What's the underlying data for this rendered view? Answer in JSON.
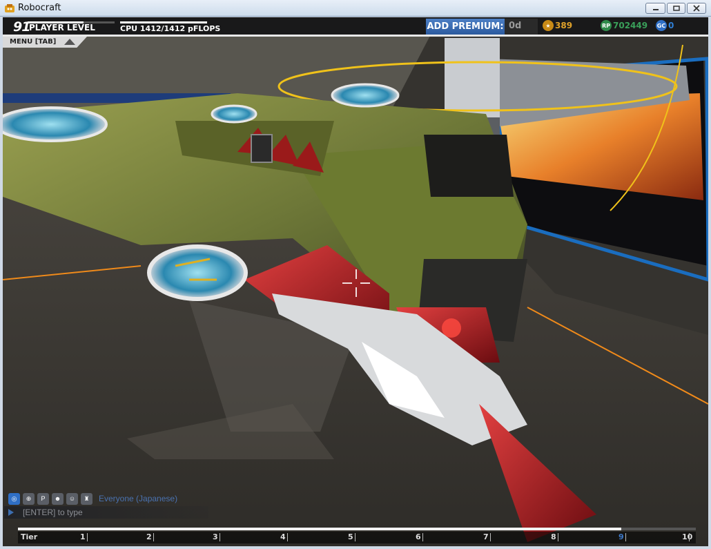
{
  "window": {
    "title": "Robocraft"
  },
  "hud": {
    "player_level": "91",
    "player_level_label": "PLAYER LEVEL",
    "level_progress": 0.64,
    "cpu": "CPU 1412/1412 pFLOPS",
    "add_premium": "ADD PREMIUM:",
    "premium_days": "0d",
    "tech_points": "389",
    "robits": "702449",
    "galaxy_coins": "0",
    "menu": "MENU [TAB]"
  },
  "chat": {
    "channel": "Everyone (Japanese)",
    "placeholder": "[ENTER] to type",
    "icons": [
      "globe-icon",
      "globe-alt-icon",
      "party-icon",
      "friends-icon",
      "friend-add-icon",
      "clan-icon"
    ]
  },
  "tier": {
    "label": "Tier",
    "numbers": [
      "1",
      "2",
      "3",
      "4",
      "5",
      "6",
      "7",
      "8",
      "9",
      "10"
    ],
    "selected": "9"
  },
  "colors": {
    "accent": "#2f5fa3",
    "tech": "#e0a22a",
    "robits": "#3aa05a",
    "gc": "#2f7fd6"
  }
}
